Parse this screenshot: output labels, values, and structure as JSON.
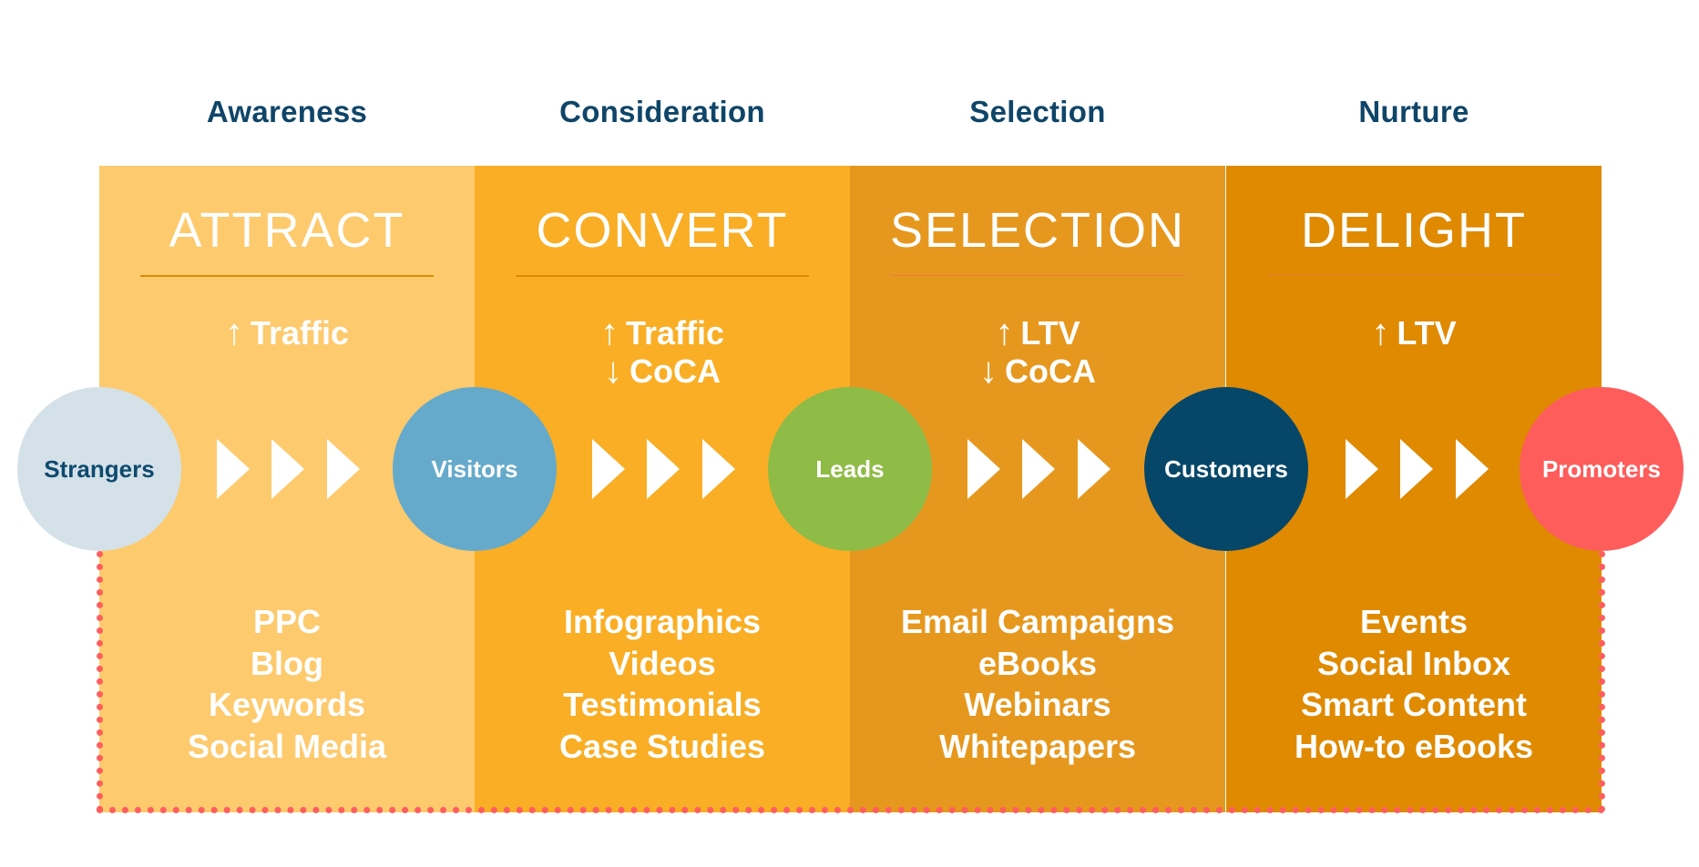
{
  "stages": [
    {
      "header": "Awareness",
      "title": "ATTRACT",
      "band_color": "#FDCA6E",
      "underline_color": "#DF8A00",
      "metrics": [
        {
          "direction": "up",
          "arrow": "↑",
          "label": "Traffic"
        }
      ],
      "tactics": [
        "PPC",
        "Blog",
        "Keywords",
        "Social Media"
      ]
    },
    {
      "header": "Consideration",
      "title": "CONVERT",
      "band_color": "#F9AE25",
      "underline_color": "#DF8A00",
      "metrics": [
        {
          "direction": "up",
          "arrow": "↑",
          "label": "Traffic"
        },
        {
          "direction": "down",
          "arrow": "↓",
          "label": "CoCA"
        }
      ],
      "tactics": [
        "Infographics",
        "Videos",
        "Testimonials",
        "Case Studies"
      ]
    },
    {
      "header": "Selection",
      "title": "SELECTION",
      "band_color": "#E6981E",
      "underline_color": "#F07A3C",
      "metrics": [
        {
          "direction": "up",
          "arrow": "↑",
          "label": "LTV"
        },
        {
          "direction": "down",
          "arrow": "↓",
          "label": "CoCA"
        }
      ],
      "tactics": [
        "Email Campaigns",
        "eBooks",
        "Webinars",
        "Whitepapers"
      ]
    },
    {
      "header": "Nurture",
      "title": "DELIGHT",
      "band_color": "#DF8A00",
      "underline_color": "#F07A3C",
      "metrics": [
        {
          "direction": "up",
          "arrow": "↑",
          "label": "LTV"
        }
      ],
      "tactics": [
        "Events",
        "Social Inbox",
        "Smart Content",
        "How-to eBooks"
      ]
    }
  ],
  "nodes": [
    {
      "label": "Strangers",
      "fill": "#D4E1E9",
      "text_color": "#0D4A6E"
    },
    {
      "label": "Visitors",
      "fill": "#66AACB",
      "text_color": "#FFFFFF"
    },
    {
      "label": "Leads",
      "fill": "#8FBB47",
      "text_color": "#FFFFFF"
    },
    {
      "label": "Customers",
      "fill": "#064769",
      "text_color": "#FFFFFF"
    },
    {
      "label": "Promoters",
      "fill": "#FF5C5C",
      "text_color": "#FFFFFF"
    }
  ],
  "colors": {
    "header_text": "#0F4568",
    "dotted_border": "#FF5E5E",
    "chevron": "#FFFFFF"
  }
}
